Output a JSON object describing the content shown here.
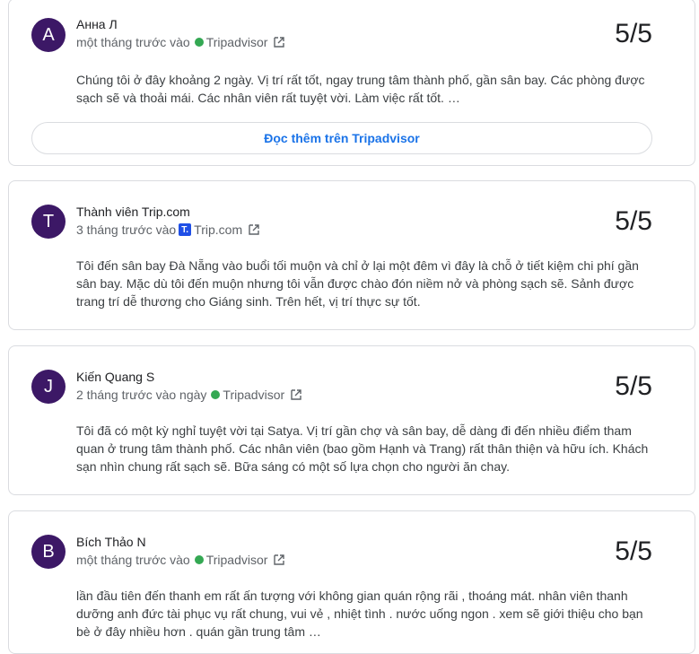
{
  "colors": {
    "avatar_bg": "#3c1866",
    "link": "#1a73e8",
    "tripadvisor_dot": "#34a853",
    "tripcom_logo": "#1f4fe6"
  },
  "reviews": [
    {
      "initial": "A",
      "name": "Анна Л",
      "time": "một tháng trước vào",
      "source": "Tripadvisor",
      "source_icon": "tripadvisor-icon",
      "score": "5/5",
      "text": "Chúng tôi ở đây khoảng 2 ngày. Vị trí rất tốt, ngay trung tâm thành phố, gần sân bay. Các phòng được sạch sẽ và thoải mái. Các nhân viên rất tuyệt vời. Làm việc rất tốt. …",
      "read_more": "Đọc thêm trên Tripadvisor"
    },
    {
      "initial": "T",
      "name": "Thành viên Trip.com",
      "time": "3 tháng trước vào",
      "source": "Trip.com",
      "source_icon": "tripcom-icon",
      "source_logo_letter": "T.",
      "score": "5/5",
      "text": "Tôi đến sân bay Đà Nẵng vào buổi tối muộn và chỉ ở lại một đêm vì đây là chỗ ở tiết kiệm chi phí gần sân bay. Mặc dù tôi đến muộn nhưng tôi vẫn được chào đón niềm nở và phòng sạch sẽ. Sảnh được trang trí dễ thương cho Giáng sinh. Trên hết, vị trí thực sự tốt."
    },
    {
      "initial": "J",
      "name": "Kiến Quang S",
      "time": "2 tháng trước vào ngày",
      "source": "Tripadvisor",
      "source_icon": "tripadvisor-icon",
      "score": "5/5",
      "text": "Tôi đã có một kỳ nghỉ tuyệt vời tại Satya. Vị trí gần chợ và sân bay, dễ dàng đi đến nhiều điểm tham quan ở trung tâm thành phố. Các nhân viên (bao gồm Hạnh và Trang) rất thân thiện và hữu ích. Khách sạn nhìn chung rất sạch sẽ. Bữa sáng có một số lựa chọn cho người ăn chay."
    },
    {
      "initial": "B",
      "name": "Bích Thảo N",
      "time": "một tháng trước vào",
      "source": "Tripadvisor",
      "source_icon": "tripadvisor-icon",
      "score": "5/5",
      "text": "lần đầu tiên đến thanh em rất ấn tượng với không gian quán rộng rãi , thoáng mát. nhân viên thanh dưỡng anh đức tài phục vụ rất chung, vui vẻ , nhiệt tình . nước uống ngon . xem sẽ giới thiệu cho bạn bè ở đây nhiều hơn . quán gần trung tâm …"
    }
  ]
}
